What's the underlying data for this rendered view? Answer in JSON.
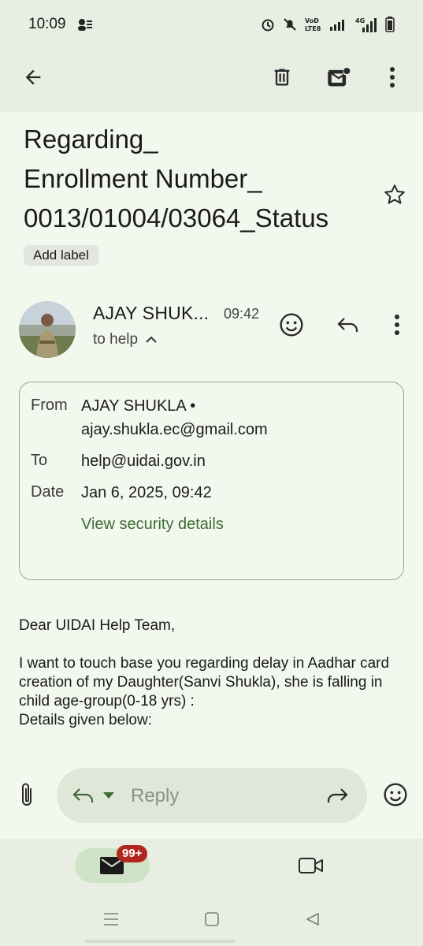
{
  "status_bar": {
    "time": "10:09",
    "icons": [
      "contacts-icon",
      "alarm-icon",
      "mute-icon",
      "volte-icon",
      "signal-icon",
      "4g-signal-icon",
      "battery-icon"
    ],
    "volte_label": "VoD LTE8",
    "network_label": "4G"
  },
  "toolbar": {
    "back": "back-arrow-icon",
    "delete": "delete-icon",
    "mark_unread": "mark-unread-icon",
    "more": "more-vert-icon"
  },
  "email": {
    "subject": "Regarding_\nEnrollment Number_\n0013/01004/03064_Status",
    "add_label": "Add label",
    "sender_name": "AJAY SHUK...",
    "time": "09:42",
    "to_line": "to help",
    "details": {
      "from_label": "From",
      "from_value": "AJAY SHUKLA • ajay.shukla.ec@gmail.com",
      "to_label": "To",
      "to_value": "help@uidai.gov.in",
      "date_label": "Date",
      "date_value": "Jan 6, 2025, 09:42",
      "security_link": "View security details"
    },
    "body": {
      "greeting": "Dear UIDAI Help Team,",
      "paragraph": "I want to touch base you regarding delay in Aadhar card creation of my Daughter(Sanvi Shukla), she is falling in child age-group(0-18 yrs) :",
      "details_line": "Details given below:"
    }
  },
  "reply_bar": {
    "placeholder": "Reply"
  },
  "bottom_nav": {
    "mail_badge": "99+"
  },
  "colors": {
    "background": "#f3f8ee",
    "bar": "#e8eee2",
    "accent_green": "#3d6b35",
    "badge_red": "#b3261e"
  }
}
